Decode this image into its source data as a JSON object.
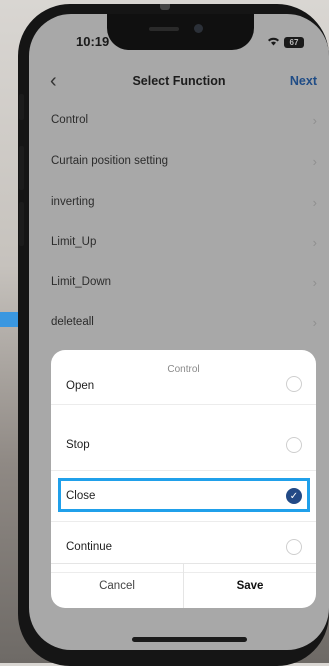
{
  "status_bar": {
    "time": "10:19",
    "battery": "67"
  },
  "nav": {
    "title": "Select Function",
    "next_label": "Next"
  },
  "function_list": [
    {
      "label": "Control"
    },
    {
      "label": "Curtain position setting"
    },
    {
      "label": "inverting"
    },
    {
      "label": "Limit_Up"
    },
    {
      "label": "Limit_Down"
    },
    {
      "label": "deleteall"
    }
  ],
  "sheet": {
    "title": "Control",
    "options": [
      {
        "label": "Open",
        "selected": false
      },
      {
        "label": "Stop",
        "selected": false
      },
      {
        "label": "Close",
        "selected": true
      },
      {
        "label": "Continue",
        "selected": false
      }
    ],
    "cancel_label": "Cancel",
    "save_label": "Save"
  },
  "colors": {
    "accent": "#20a0ea",
    "selected_radio": "#234a86",
    "next_link": "#1f4c86"
  }
}
